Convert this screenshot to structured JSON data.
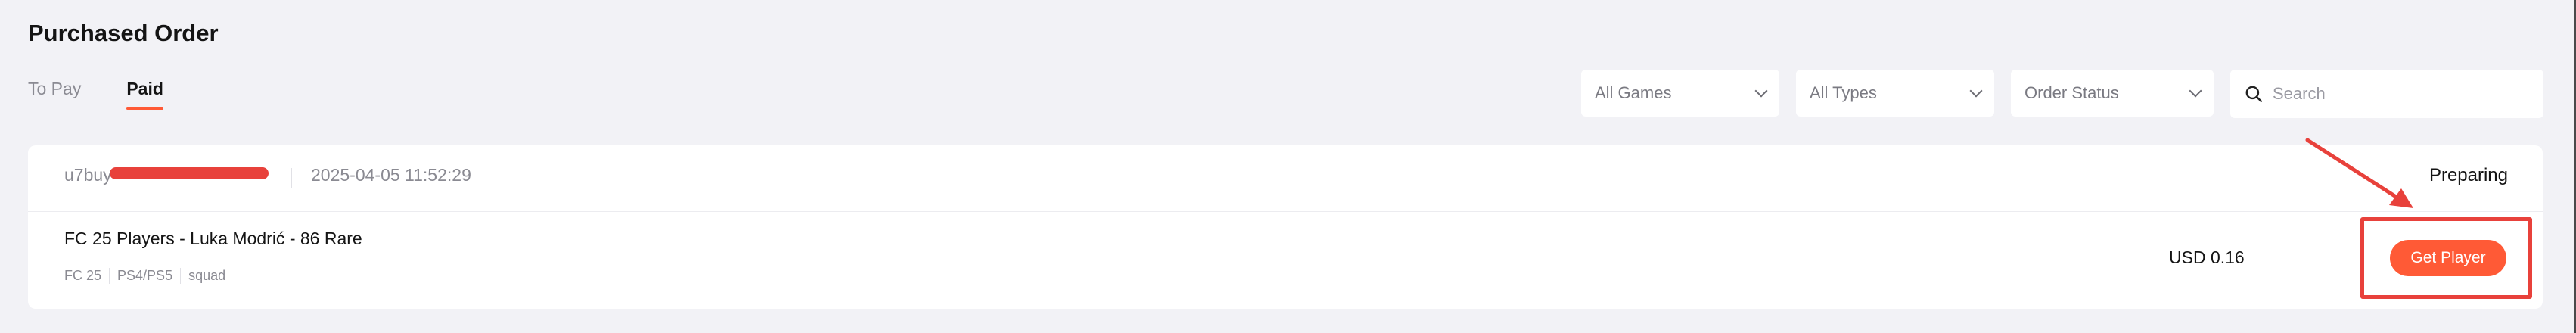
{
  "page": {
    "title": "Purchased Order"
  },
  "tabs": [
    {
      "label": "To Pay",
      "active": false
    },
    {
      "label": "Paid",
      "active": true
    }
  ],
  "filters": {
    "games": "All Games",
    "types": "All Types",
    "status": "Order Status",
    "search_placeholder": "Search"
  },
  "order": {
    "id_prefix": "u7buy",
    "time": "2025-04-05 11:52:29",
    "status": "Preparing",
    "product_name": "FC 25 Players - Luka Modrić - 86 Rare",
    "tags": [
      "FC 25",
      "PS4/PS5",
      "squad"
    ],
    "price": "USD 0.16",
    "action_label": "Get Player"
  },
  "colors": {
    "accent": "#ff5a36",
    "annotation": "#e8413b",
    "background": "#f2f2f6"
  },
  "icons": {
    "search": "search-icon",
    "chevron": "chevron-down-icon"
  }
}
